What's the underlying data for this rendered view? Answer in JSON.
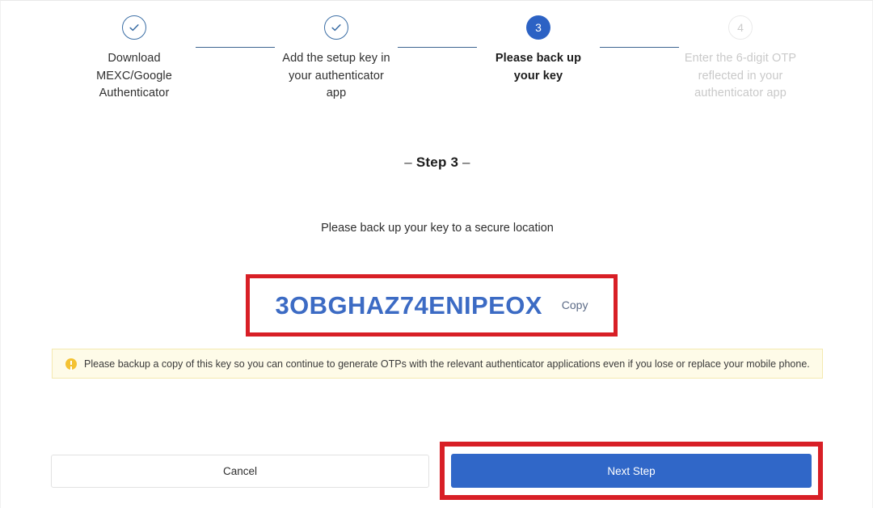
{
  "stepper": {
    "steps": [
      {
        "marker": "check-icon",
        "state": "done",
        "label": "Download MEXC/Google Authenticator"
      },
      {
        "marker": "check-icon",
        "state": "done",
        "label": "Add the setup key in your authenticator app"
      },
      {
        "marker": "3",
        "state": "active",
        "label": "Please back up your key"
      },
      {
        "marker": "4",
        "state": "pending",
        "label": "Enter the 6-digit OTP reflected in your authenticator app"
      }
    ]
  },
  "main": {
    "step_title_prefix": "–",
    "step_title": "Step 3",
    "step_title_suffix": "–",
    "subtitle": "Please back up your key to a secure location",
    "secret_key": "3OBGHAZ74ENIPEOX",
    "copy_label": "Copy",
    "warning_text": "Please backup a copy of this key so you can continue to generate OTPs with the relevant authenticator applications even if you lose or replace your mobile phone."
  },
  "footer": {
    "cancel_label": "Cancel",
    "next_label": "Next Step"
  },
  "colors": {
    "accent_blue": "#3067c8",
    "key_blue": "#3c6bc4",
    "highlight_red": "#d81f26",
    "warning_bg": "#fefbe8",
    "warning_border": "#f4e9b0",
    "warning_icon": "#f4c232",
    "connector": "#3d6591",
    "pending_grey": "#c9c9c9"
  }
}
